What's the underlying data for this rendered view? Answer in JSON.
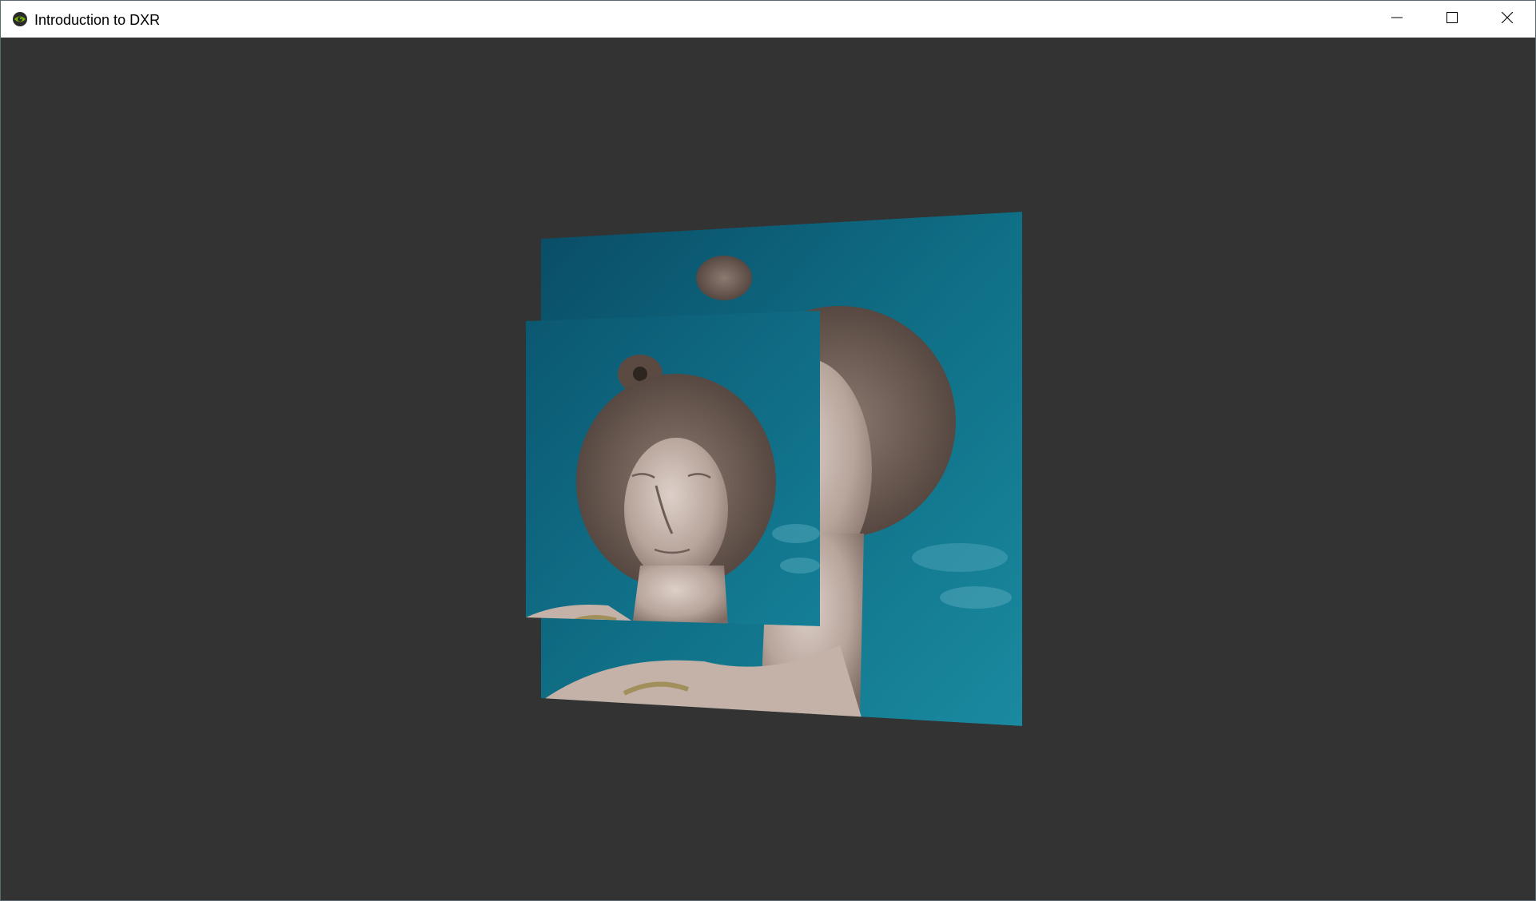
{
  "window": {
    "title": "Introduction to DXR",
    "app_icon": "nvidia-eye-icon",
    "controls": {
      "minimize_icon": "minimize-icon",
      "maximize_icon": "maximize-icon",
      "close_icon": "close-icon"
    }
  },
  "viewport": {
    "background_color": "#333333",
    "scene": {
      "objects": [
        {
          "name": "back-textured-quad",
          "texture": "statue-head-photo"
        },
        {
          "name": "front-textured-quad",
          "texture": "statue-head-photo"
        }
      ],
      "sky_color": "#0f6f86",
      "stone_color": "#c9b8b0"
    }
  }
}
